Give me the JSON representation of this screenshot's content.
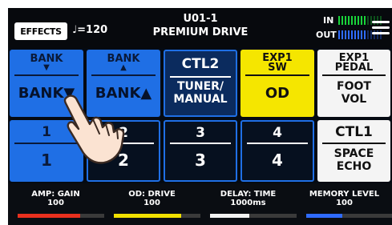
{
  "header": {
    "effects_label": "EFFECTS",
    "tempo": "♩=120",
    "patch_number": "U01-1",
    "patch_name": "PREMIUM DRIVE",
    "in_label": "IN",
    "out_label": "OUT",
    "in_meter_color": "#19d43a",
    "out_meter_color": "#2f6bff"
  },
  "buttons": {
    "bank_down": {
      "line1": "BANK",
      "arrow": "▼",
      "assign": "BANK▼"
    },
    "bank_up": {
      "line1": "BANK",
      "arrow": "▲",
      "assign": "BANK▲"
    },
    "ctl2": {
      "line1": "CTL2",
      "assign1": "TUNER/",
      "assign2": "MANUAL"
    },
    "exp1_sw": {
      "line1": "EXP1",
      "line2": "SW",
      "assign": "OD"
    },
    "exp1_pedal": {
      "line1": "EXP1",
      "line2": "PEDAL",
      "assign1": "FOOT",
      "assign2": "VOL"
    },
    "num1": {
      "top": "1",
      "bottom": "1"
    },
    "num2": {
      "top": "2",
      "bottom": "2"
    },
    "num3": {
      "top": "3",
      "bottom": "3"
    },
    "num4": {
      "top": "4",
      "bottom": "4"
    },
    "ctl1": {
      "line1": "CTL1",
      "assign1": "SPACE",
      "assign2": "ECHO"
    }
  },
  "params": [
    {
      "name": "AMP: GAIN",
      "value": "100",
      "level": 0.72,
      "color": "#e8301e"
    },
    {
      "name": "OD: DRIVE",
      "value": "100",
      "level": 0.78,
      "color": "#f0e000"
    },
    {
      "name": "DELAY: TIME",
      "value": "1000ms",
      "level": 0.45,
      "color": "#f2f2f2"
    },
    {
      "name": "MEMORY LEVEL",
      "value": "100",
      "level": 0.42,
      "color": "#2f6bff"
    }
  ],
  "colors": {
    "blue": "#1f6fe5",
    "dark_blue": "#0b2b5e",
    "yellow": "#f5e600",
    "white": "#f4f4f4"
  }
}
